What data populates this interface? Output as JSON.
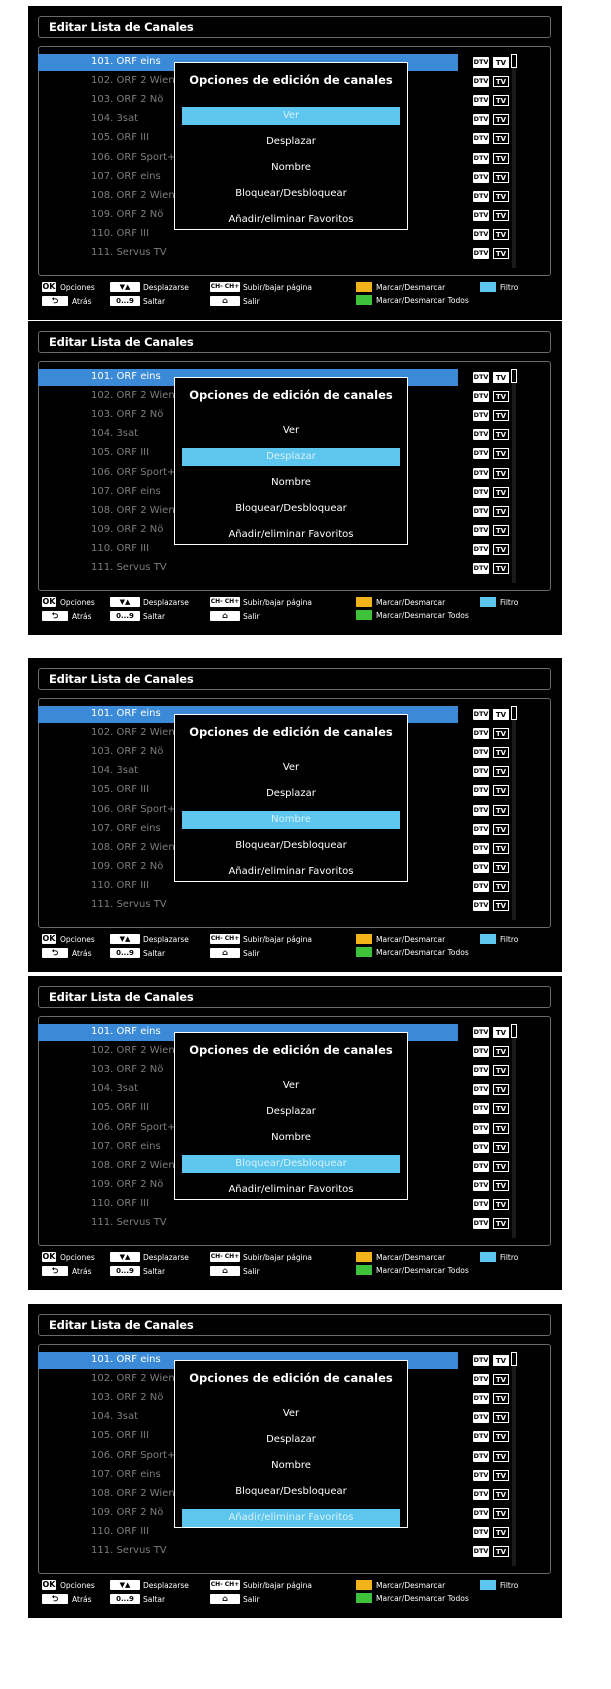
{
  "screen": {
    "title": "Editar Lista de Canales",
    "channels": [
      "101. ORF eins",
      "102. ORF 2 Wien",
      "103. ORF 2 Nö",
      "104. 3sat",
      "105. ORF III",
      "106. ORF Sport+",
      "107. ORF eins",
      "108. ORF 2 Wien",
      "109. ORF 2 Nö",
      "110. ORF III",
      "111. Servus TV"
    ],
    "badge_dtv": "DTV",
    "badge_tv": "TV",
    "popup_title": "Opciones de edición de canales",
    "menu": [
      "Ver",
      "Desplazar",
      "Nombre",
      "Bloquear/Desbloquear",
      "Añadir/eliminar Favoritos"
    ],
    "footer": {
      "ok_key": "OK",
      "ok_label": "Opciones",
      "back_key": "⮌",
      "back_label": "Atrás",
      "arrows_key": "▼▲",
      "arrows_label": "Desplazarse",
      "num_key": "0...9",
      "num_label": "Saltar",
      "ch_key": "CH- CH+",
      "ch_label": "Subir/bajar página",
      "home_label": "Salir",
      "yellow_label": "Marcar/Desmarcar",
      "green_label": "Marcar/Desmarcar Todos",
      "blue_label": "Filtro"
    }
  },
  "panels": [
    {
      "selected_menu_index": 0
    },
    {
      "selected_menu_index": 1
    },
    {
      "selected_menu_index": 2
    },
    {
      "selected_menu_index": 3
    },
    {
      "selected_menu_index": 4
    }
  ],
  "colors": {
    "selection_blue": "#3a8ad8",
    "menu_highlight": "#5cc6ee",
    "yellow_key": "#f2b21a",
    "green_key": "#3ec23a",
    "blue_key": "#5cc6ee"
  }
}
